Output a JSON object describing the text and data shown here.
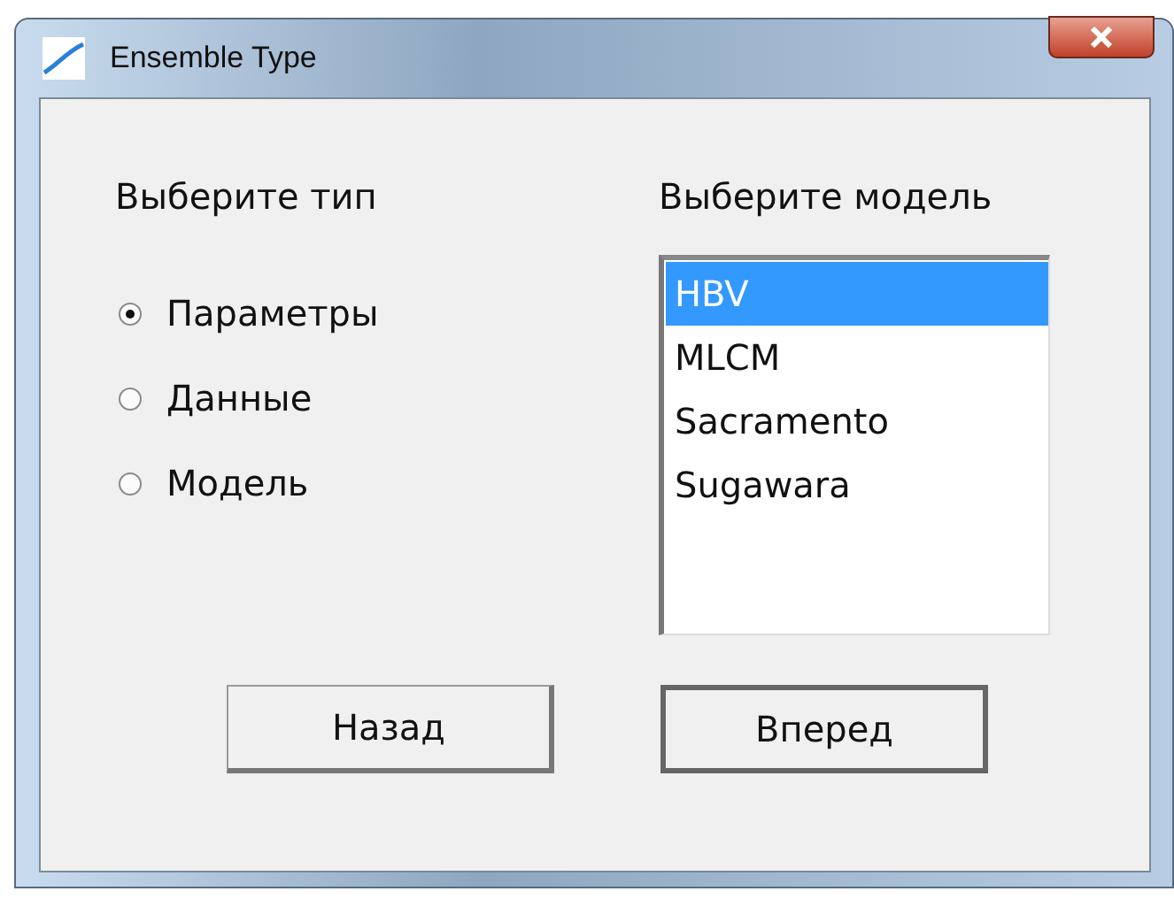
{
  "window": {
    "title": "Ensemble Type"
  },
  "type_group": {
    "label": "Выберите тип",
    "options": [
      {
        "label": "Параметры",
        "selected": true
      },
      {
        "label": "Данные",
        "selected": false
      },
      {
        "label": "Модель",
        "selected": false
      }
    ]
  },
  "model_group": {
    "label": "Выберите модель",
    "items": [
      {
        "label": "HBV",
        "selected": true
      },
      {
        "label": "MLCM",
        "selected": false
      },
      {
        "label": "Sacramento",
        "selected": false
      },
      {
        "label": "Sugawara",
        "selected": false
      }
    ]
  },
  "buttons": [
    {
      "label": "Назад",
      "default": false
    },
    {
      "label": "Вперед",
      "default": true
    }
  ]
}
